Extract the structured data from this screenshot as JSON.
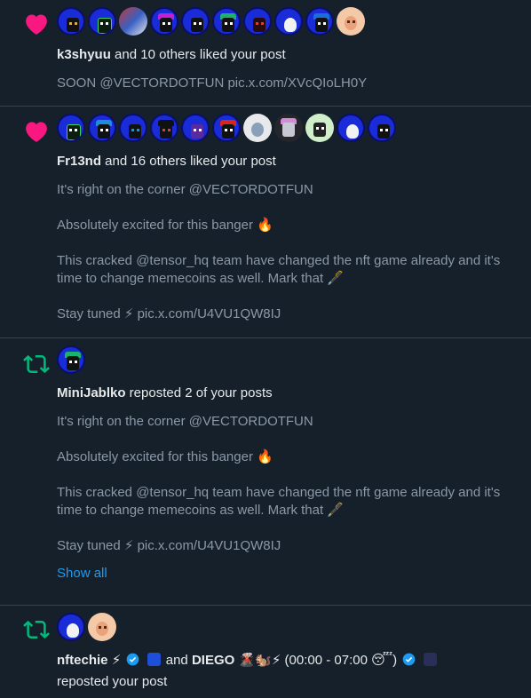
{
  "colors": {
    "background": "#15202b",
    "divider": "#38444d",
    "like": "#f91880",
    "repost": "#00ba7c",
    "link": "#1d9bf0",
    "muted_text": "#8b98a5"
  },
  "notifications": [
    {
      "type": "like",
      "icon": "heart-icon",
      "avatar_count": 10,
      "actor": "k3shyuu",
      "action": " and 10 others liked your post",
      "paragraphs": [
        "SOON @VECTORDOTFUN pic.x.com/XVcQIoLH0Y"
      ]
    },
    {
      "type": "like",
      "icon": "heart-icon",
      "avatar_count": 11,
      "actor": "Fr13nd",
      "action": " and 16 others liked your post",
      "paragraphs": [
        "It's right on the corner @VECTORDOTFUN",
        "Absolutely excited for this banger 🔥",
        "This cracked @tensor_hq team have changed the nft game already and it's time to change memecoins as well. Mark that 🖋️",
        "Stay tuned ⚡ pic.x.com/U4VU1QW8IJ"
      ]
    },
    {
      "type": "repost",
      "icon": "repost-icon",
      "avatar_count": 1,
      "actor": "MiniJablko",
      "action": " reposted 2 of your posts",
      "paragraphs": [
        "It's right on the corner @VECTORDOTFUN",
        "Absolutely excited for this banger 🔥",
        "This cracked @tensor_hq team have changed the nft game already and it's time to change memecoins as well. Mark that 🖋️",
        "Stay tuned ⚡ pic.x.com/U4VU1QW8IJ"
      ],
      "show_all": "Show all"
    },
    {
      "type": "repost",
      "icon": "repost-icon",
      "avatar_count": 2,
      "actor": "nftechie",
      "actor_suffix": "⚡",
      "joiner": " and ",
      "actor2": "DIEGO",
      "actor2_suffix": "🌋🐿️⚡ (00:00 - 07:00 😴)",
      "action": "reposted your post"
    }
  ]
}
